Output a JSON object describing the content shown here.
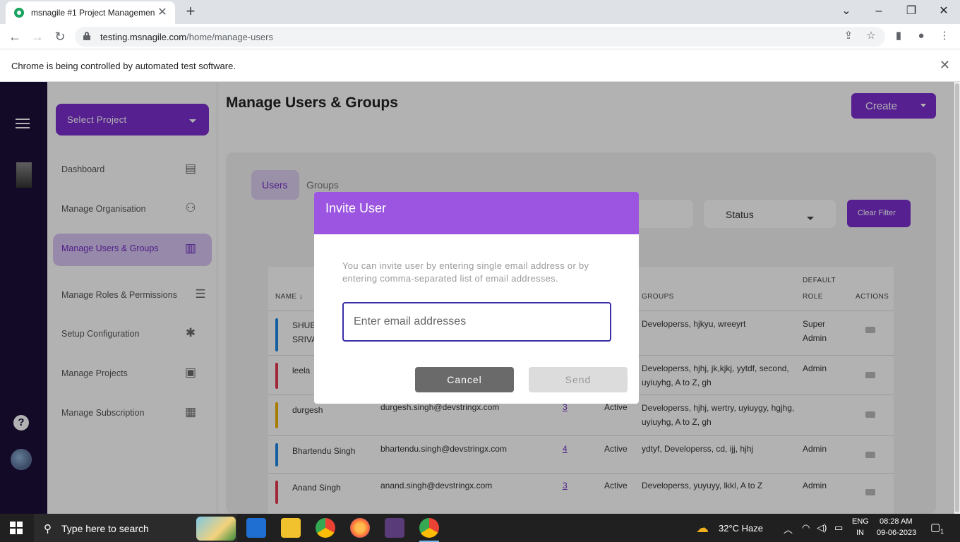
{
  "browser": {
    "tab_title": "msnagile #1 Project Managemen",
    "url_host": "testing.msnagile.com",
    "url_path": "/home/manage-users",
    "automation_notice": "Chrome is being controlled by automated test software."
  },
  "sidebar": {
    "select_project": "Select Project",
    "items": [
      {
        "label": "Dashboard",
        "icon": "monitor-icon"
      },
      {
        "label": "Manage Organisation",
        "icon": "org-icon"
      },
      {
        "label": "Manage Users & Groups",
        "icon": "users-grid-icon",
        "active": true
      },
      {
        "label": "Manage Roles & Permissions",
        "icon": "server-icon"
      },
      {
        "label": "Setup Configuration",
        "icon": "puzzle-icon"
      },
      {
        "label": "Manage Projects",
        "icon": "clipboard-icon"
      },
      {
        "label": "Manage Subscription",
        "icon": "subscription-icon"
      }
    ]
  },
  "header": {
    "title": "Manage Users & Groups",
    "create_label": "Create"
  },
  "tabs": {
    "users": "Users",
    "groups": "Groups"
  },
  "filters": {
    "status": "Status",
    "clear": "Clear Filter"
  },
  "table": {
    "headers": {
      "name": "NAME",
      "groups": "GROUPS",
      "default_role_1": "DEFAULT",
      "default_role_2": "ROLE",
      "actions": "ACTIONS"
    },
    "rows": [
      {
        "name1": "SHUB",
        "name2": "SRIVA",
        "email": "",
        "count": "",
        "status": "",
        "groups": "Developerss, hjkyu, wreeyrt",
        "role1": "Super",
        "role2": "Admin",
        "color": "#1e88e5"
      },
      {
        "name1": "leela",
        "name2": "",
        "email": "",
        "count": "",
        "status": "",
        "groups": "Developerss, hjhj, jk,kjkj, yytdf, second, uyiuyhg, A to Z, gh",
        "role1": "Admin",
        "role2": "",
        "color": "#e53950"
      },
      {
        "name1": "durgesh",
        "name2": "",
        "email": "durgesh.singh@devstringx.com",
        "count": "3",
        "status": "Active",
        "groups": "Developerss, hjhj, wertry, uyiuygy, hgjhg, uyiuyhg, A to Z, gh",
        "role1": "",
        "role2": "",
        "color": "#f0b400"
      },
      {
        "name1": "Bhartendu Singh",
        "name2": "",
        "email": "bhartendu.singh@devstringx.com",
        "count": "4",
        "status": "Active",
        "groups": "ydtyf, Developerss, cd, ijj, hjhj",
        "role1": "Admin",
        "role2": "",
        "color": "#1e88e5"
      },
      {
        "name1": "Anand Singh",
        "name2": "",
        "email": "anand.singh@devstringx.com",
        "count": "3",
        "status": "Active",
        "groups": "Developerss, yuyuyy, lkkl, A to Z",
        "role1": "Admin",
        "role2": "",
        "color": "#e53950"
      }
    ]
  },
  "modal": {
    "title": "Invite User",
    "description": "You can invite user by entering single email address or by entering comma-separated list of email addresses.",
    "email_placeholder": "Enter email addresses",
    "cancel_label": "Cancel",
    "send_label": "Send"
  },
  "taskbar": {
    "search_placeholder": "Type here to search",
    "weather": "32°C  Haze",
    "lang1": "ENG",
    "lang2": "IN",
    "time": "08:28 AM",
    "date": "09-06-2023",
    "notifications": "1"
  },
  "colors": {
    "accent": "#7b2fd0",
    "modal_header": "#9b55e0",
    "rail": "#1c0f3a"
  }
}
